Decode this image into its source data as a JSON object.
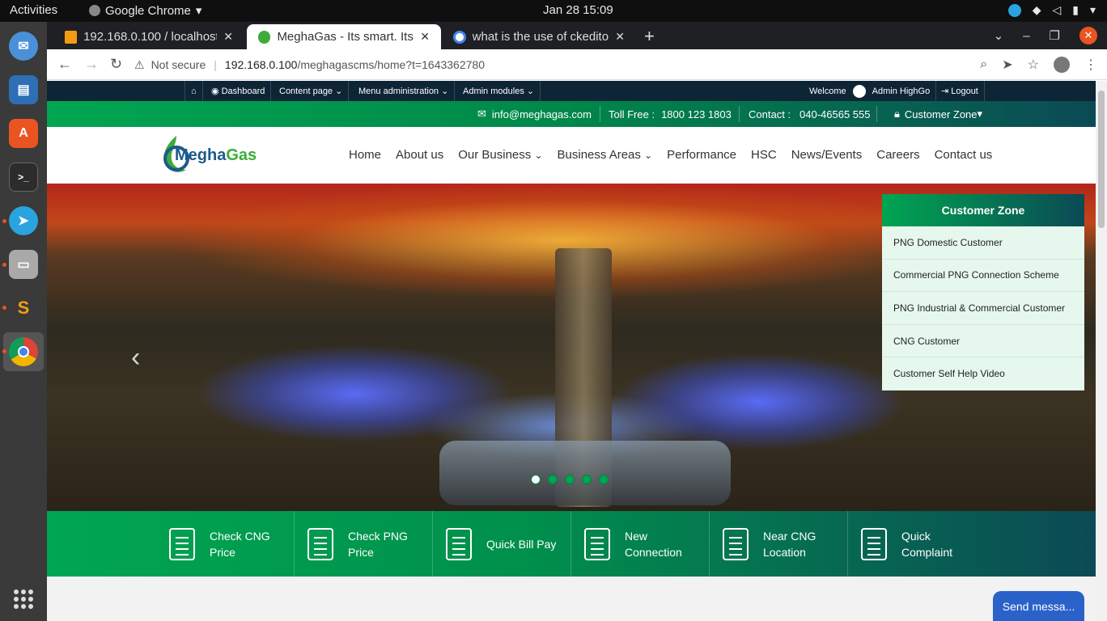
{
  "os": {
    "activities": "Activities",
    "app_name": "Google Chrome",
    "clock": "Jan 28  15:09"
  },
  "browser": {
    "tabs": [
      {
        "title": "192.168.0.100 / localhost /",
        "active": false
      },
      {
        "title": "MeghaGas - Its smart. Its g",
        "active": true
      },
      {
        "title": "what is the use of ckedito",
        "active": false
      }
    ],
    "url_warning": "Not secure",
    "url_host": "192.168.0.100",
    "url_path": "/meghagascms/home?t=1643362780"
  },
  "admin_bar": {
    "home_icon": "home-icon",
    "dashboard": "Dashboard",
    "content_page": "Content page",
    "menu_admin": "Menu administration",
    "admin_modules": "Admin modules",
    "welcome": "Welcome",
    "user": "Admin HighGo",
    "logout": "Logout"
  },
  "contact_bar": {
    "email": "info@meghagas.com",
    "toll_free_label": "Toll Free :",
    "toll_free": "1800 123 1803",
    "contact_label": "Contact :",
    "contact": "040-46565 555",
    "customer_zone": "Customer Zone"
  },
  "logo": {
    "part1": "Megha",
    "part2": "Gas"
  },
  "nav": {
    "home": "Home",
    "about": "About us",
    "business": "Our Business",
    "areas": "Business Areas",
    "performance": "Performance",
    "hsc": "HSC",
    "news": "News/Events",
    "careers": "Careers",
    "contact": "Contact us"
  },
  "customer_zone_panel": {
    "title": "Customer Zone",
    "items": [
      "PNG Domestic Customer",
      "Commercial PNG Connection Scheme",
      "PNG Industrial & Commercial Customer",
      "CNG Customer",
      "Customer Self Help Video"
    ]
  },
  "quick_links": [
    {
      "line1": "Check CNG",
      "line2": "Price"
    },
    {
      "line1": "Check PNG",
      "line2": "Price"
    },
    {
      "line1": "Quick Bill Pay",
      "line2": ""
    },
    {
      "line1": "New",
      "line2": "Connection"
    },
    {
      "line1": "Near CNG",
      "line2": "Location"
    },
    {
      "line1": "Quick",
      "line2": "Complaint"
    }
  ],
  "chat": {
    "label": "Send messa..."
  },
  "colors": {
    "brand_green": "#00a651",
    "dark_teal": "#0b4a55",
    "admin_navy": "#0d2535"
  }
}
